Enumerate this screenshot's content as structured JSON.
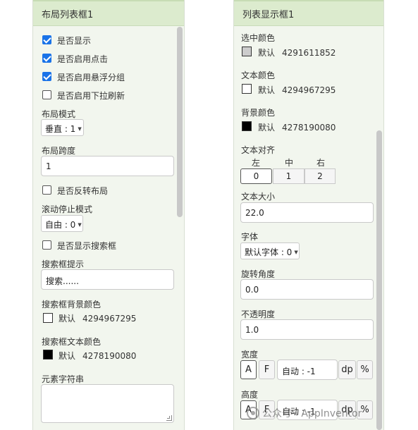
{
  "left": {
    "title": "布局列表框1",
    "show": {
      "label": "是否显示",
      "checked": true
    },
    "click": {
      "label": "是否启用点击",
      "checked": true
    },
    "floatgroup": {
      "label": "是否启用悬浮分组",
      "checked": true
    },
    "pulldown": {
      "label": "是否启用下拉刷新",
      "checked": false
    },
    "layout_mode": {
      "label": "布局模式",
      "value": "垂直 : 1"
    },
    "layout_span": {
      "label": "布局跨度",
      "value": "1"
    },
    "reverse": {
      "label": "是否反转布局",
      "checked": false
    },
    "scroll_stop": {
      "label": "滚动停止模式",
      "value": "自由 : 0"
    },
    "show_search": {
      "label": "是否显示搜索框",
      "checked": false
    },
    "search_hint": {
      "label": "搜索框提示",
      "value": "搜索......"
    },
    "search_bg": {
      "label": "搜索框背景颜色",
      "name": "默认",
      "value": "4294967295",
      "color": "#ffffff"
    },
    "search_text": {
      "label": "搜索框文本颜色",
      "name": "默认",
      "value": "4278190080",
      "color": "#000000"
    },
    "elements": {
      "label": "元素字符串",
      "value": ""
    }
  },
  "right": {
    "title": "列表显示框1",
    "selected_color": {
      "label": "选中颜色",
      "name": "默认",
      "value": "4291611852",
      "color": "#cccccc"
    },
    "text_color": {
      "label": "文本颜色",
      "name": "默认",
      "value": "4294967295",
      "color": "#ffffff"
    },
    "bg_color": {
      "label": "背景颜色",
      "name": "默认",
      "value": "4278190080",
      "color": "#000000"
    },
    "align": {
      "label": "文本对齐",
      "headers": [
        "左",
        "中",
        "右"
      ],
      "options": [
        "0",
        "1",
        "2"
      ],
      "selected": "0"
    },
    "text_size": {
      "label": "文本大小",
      "value": "22.0"
    },
    "font": {
      "label": "字体",
      "value": "默认字体 : 0"
    },
    "rotation": {
      "label": "旋转角度",
      "value": "0.0"
    },
    "opacity": {
      "label": "不透明度",
      "value": "1.0"
    },
    "width": {
      "label": "宽度",
      "a": "A",
      "f": "F",
      "value": "自动 : -1",
      "dp": "dp",
      "pct": "%"
    },
    "height": {
      "label": "高度",
      "a": "A",
      "f": "F",
      "value": "自动 : -1",
      "dp": "dp",
      "pct": "%"
    }
  },
  "watermark": {
    "text": "公众号 · AppInventor"
  },
  "colors": {
    "checkbox": "#1a73e8",
    "header_bg": "#dcebce",
    "panel_bg": "#f2f6ee"
  }
}
